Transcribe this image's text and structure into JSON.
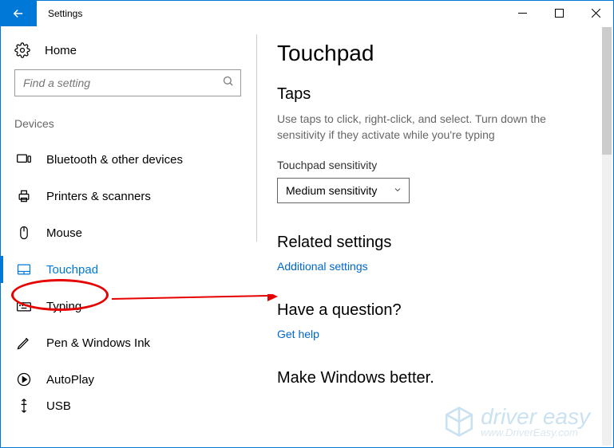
{
  "window": {
    "title": "Settings"
  },
  "sidebar": {
    "home_label": "Home",
    "search_placeholder": "Find a setting",
    "category": "Devices",
    "items": [
      {
        "label": "Bluetooth & other devices"
      },
      {
        "label": "Printers & scanners"
      },
      {
        "label": "Mouse"
      },
      {
        "label": "Touchpad"
      },
      {
        "label": "Typing"
      },
      {
        "label": "Pen & Windows Ink"
      },
      {
        "label": "AutoPlay"
      },
      {
        "label": "USB"
      }
    ]
  },
  "main": {
    "page_title": "Touchpad",
    "taps_header": "Taps",
    "taps_desc": "Use taps to click, right-click, and select. Turn down the sensitivity if they activate while you're typing",
    "sensitivity_label": "Touchpad sensitivity",
    "sensitivity_value": "Medium sensitivity",
    "related_header": "Related settings",
    "related_link": "Additional settings",
    "question_header": "Have a question?",
    "help_link": "Get help",
    "better_header": "Make Windows better."
  },
  "watermark": {
    "brand": "driver easy",
    "url": "www.DriverEasy.com"
  }
}
